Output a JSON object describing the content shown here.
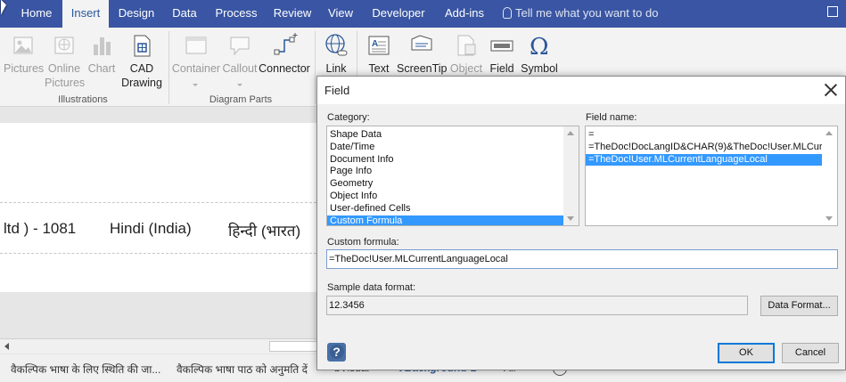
{
  "ribbon": {
    "tabs": [
      "Home",
      "Insert",
      "Design",
      "Data",
      "Process",
      "Review",
      "View",
      "Developer",
      "Add-ins"
    ],
    "active_tab": "Insert",
    "tell_me": "Tell me what you want to do",
    "buttons": {
      "pictures": "Pictures",
      "online_pictures_1": "Online",
      "online_pictures_2": "Pictures",
      "chart": "Chart",
      "cad_drawing_1": "CAD",
      "cad_drawing_2": "Drawing",
      "container": "Container",
      "callout": "Callout",
      "connector": "Connector",
      "link": "Link",
      "text": "Text",
      "screentip": "ScreenTip",
      "object": "Object",
      "field": "Field",
      "symbol": "Symbol"
    },
    "groups": {
      "illustrations": "Illustrations",
      "diagram_parts": "Diagram Parts"
    }
  },
  "document": {
    "cells": [
      "ltd ) - 1081",
      "Hindi (India)",
      "हिन्दी (भारत)"
    ]
  },
  "page_tabs": [
    "वैकल्पिक भाषा के लिए स्थिति की जा...",
    "वैकल्पिक भाषा पाठ को अनुमति दें",
    "bVisual",
    "VBackground-1",
    "All"
  ],
  "page_tabs_plus": "+",
  "dialog": {
    "title": "Field",
    "category_label": "Category:",
    "category_items": [
      "Shape Data",
      "Date/Time",
      "Document Info",
      "Page Info",
      "Geometry",
      "Object Info",
      "User-defined Cells",
      "Custom Formula"
    ],
    "category_selected": "Custom Formula",
    "field_name_label": "Field name:",
    "field_name_items": [
      "=",
      "=TheDoc!DocLangID&CHAR(9)&TheDoc!User.MLCurren",
      "=TheDoc!User.MLCurrentLanguageLocal"
    ],
    "custom_formula_label": "Custom formula:",
    "custom_formula_value": "=TheDoc!User.MLCurrentLanguageLocal",
    "sample_label": "Sample data format:",
    "sample_value": "12.3456",
    "data_format_button": "Data Format...",
    "ok_button": "OK",
    "cancel_button": "Cancel",
    "help_glyph": "?"
  },
  "colors": {
    "ribbon_bar": "#3955a3",
    "selection": "#3399ff",
    "accent": "#2b579a"
  }
}
